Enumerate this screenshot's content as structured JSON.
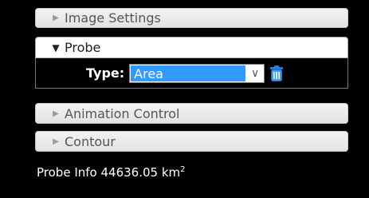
{
  "accordion": {
    "image_settings": {
      "label": "Image Settings",
      "arrow": "▶"
    },
    "probe": {
      "label": "Probe",
      "arrow": "▼"
    },
    "animation_control": {
      "label": "Animation Control",
      "arrow": "▶"
    },
    "contour": {
      "label": "Contour",
      "arrow": "▶"
    }
  },
  "probe_panel": {
    "type_label": "Type:",
    "type_value": "Area",
    "select_arrow": "∨",
    "delete_icon": "trash-icon"
  },
  "probe_info": {
    "label": "Probe Info",
    "value": "44636.05",
    "unit": "km",
    "unit_exponent": "2"
  },
  "colors": {
    "background": "#000000",
    "selected_option": "#3399ff",
    "trash_icon": "#2a7fd4"
  }
}
